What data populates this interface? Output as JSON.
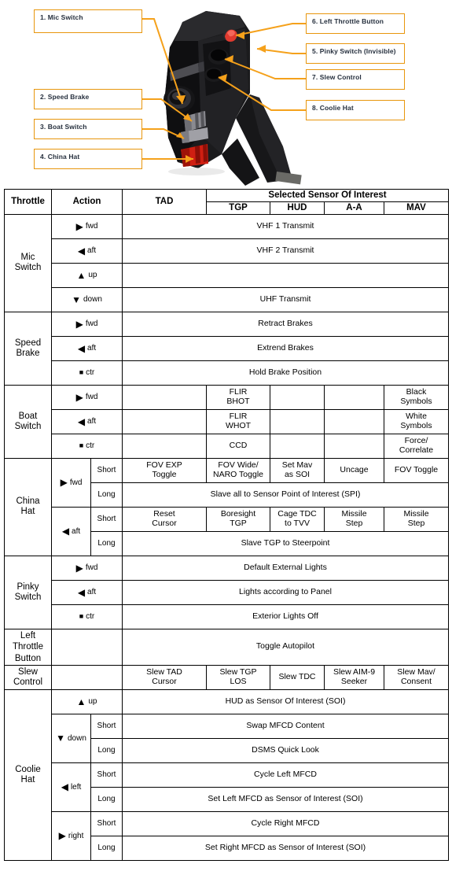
{
  "diagram": {
    "title": "A-10C Throttle (HOTAS Warthog) control callouts",
    "accent_color": "#E8960C",
    "callouts": [
      {
        "id": 1,
        "label": "1. Mic Switch"
      },
      {
        "id": 2,
        "label": "2. Speed Brake"
      },
      {
        "id": 3,
        "label": "3. Boat Switch"
      },
      {
        "id": 4,
        "label": "4. China Hat"
      },
      {
        "id": 6,
        "label": "6. Left Throttle Button"
      },
      {
        "id": 5,
        "label": "5. Pinky Switch (Invisible)"
      },
      {
        "id": 7,
        "label": "7. Slew Control"
      },
      {
        "id": 8,
        "label": "8. Coolie Hat"
      }
    ]
  },
  "table": {
    "header": {
      "throttle": "Throttle",
      "action": "Action",
      "tad": "TAD",
      "group": "Selected Sensor Of Interest",
      "tgp": "TGP",
      "hud": "HUD",
      "aa": "A-A",
      "mav": "MAV"
    },
    "glyphs": {
      "fwd": "▶",
      "aft": "◀",
      "up": "▲",
      "down": "▼",
      "ctr": "■",
      "left": "◀",
      "right": "▶"
    },
    "labels": {
      "fwd": "fwd",
      "aft": "aft",
      "up": "up",
      "down": "down",
      "ctr": "ctr",
      "left": "left",
      "right": "right",
      "short": "Short",
      "long": "Long"
    },
    "groups": {
      "mic": "Mic\nSwitch",
      "mic_l1": "Mic",
      "mic_l2": "Switch",
      "speed_l1": "Speed",
      "speed_l2": "Brake",
      "boat_l1": "Boat",
      "boat_l2": "Switch",
      "china_l1": "China",
      "china_l2": "Hat",
      "pinky_l1": "Pinky",
      "pinky_l2": "Switch",
      "ltb_l1": "Left",
      "ltb_l2": "Throttle",
      "ltb_l3": "Button",
      "slew_l1": "Slew",
      "slew_l2": "Control",
      "coolie_l1": "Coolie",
      "coolie_l2": "Hat"
    },
    "cells": {
      "mic_fwd": "VHF 1 Transmit",
      "mic_aft": "VHF 2 Transmit",
      "mic_up": "",
      "mic_down": "UHF Transmit",
      "sb_fwd": "Retract Brakes",
      "sb_aft": "Extrend Brakes",
      "sb_ctr": "Hold Brake Position",
      "boat_fwd_tgp_1": "FLIR",
      "boat_fwd_tgp_2": "BHOT",
      "boat_fwd_mav_1": "Black",
      "boat_fwd_mav_2": "Symbols",
      "boat_aft_tgp_1": "FLIR",
      "boat_aft_tgp_2": "WHOT",
      "boat_aft_mav_1": "White",
      "boat_aft_mav_2": "Symbols",
      "boat_ctr_tgp": "CCD",
      "boat_ctr_mav_1": "Force/",
      "boat_ctr_mav_2": "Correlate",
      "ch_fwd_short_tad_1": "FOV EXP",
      "ch_fwd_short_tad_2": "Toggle",
      "ch_fwd_short_tgp_1": "FOV Wide/",
      "ch_fwd_short_tgp_2": "NARO Toggle",
      "ch_fwd_short_hud_1": "Set Mav",
      "ch_fwd_short_hud_2": "as SOI",
      "ch_fwd_short_aa": "Uncage",
      "ch_fwd_short_mav": "FOV Toggle",
      "ch_fwd_long": "Slave all to Sensor Point of Interest (SPI)",
      "ch_aft_short_tad_1": "Reset",
      "ch_aft_short_tad_2": "Cursor",
      "ch_aft_short_tgp_1": "Boresight",
      "ch_aft_short_tgp_2": "TGP",
      "ch_aft_short_hud_1": "Cage TDC",
      "ch_aft_short_hud_2": "to TVV",
      "ch_aft_short_aa_1": "Missile",
      "ch_aft_short_aa_2": "Step",
      "ch_aft_short_mav_1": "Missile",
      "ch_aft_short_mav_2": "Step",
      "ch_aft_long": "Slave TGP to Steerpoint",
      "pk_fwd": "Default External Lights",
      "pk_aft": "Lights according to Panel",
      "pk_ctr": "Exterior Lights Off",
      "ltb": "Toggle Autopilot",
      "slew_tad_1": "Slew TAD",
      "slew_tad_2": "Cursor",
      "slew_tgp_1": "Slew TGP",
      "slew_tgp_2": "LOS",
      "slew_hud": "Slew TDC",
      "slew_aa_1": "Slew AIM-9",
      "slew_aa_2": "Seeker",
      "slew_mav_1": "Slew Mav/",
      "slew_mav_2": "Consent",
      "co_up": "HUD as Sensor Of Interest (SOI)",
      "co_down_short": "Swap MFCD Content",
      "co_down_long": "DSMS Quick Look",
      "co_left_short": "Cycle Left MFCD",
      "co_left_long": "Set Left MFCD as Sensor of Interest (SOI)",
      "co_right_short": "Cycle Right MFCD",
      "co_right_long": "Set Right MFCD as Sensor of Interest (SOI)"
    }
  }
}
